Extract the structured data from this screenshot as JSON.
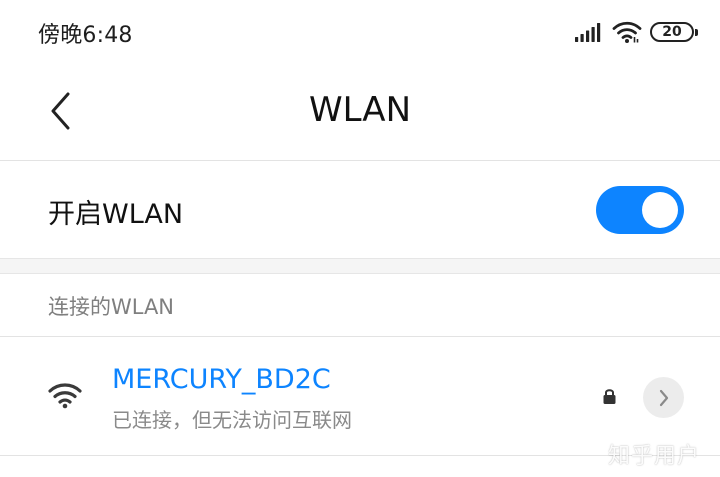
{
  "status_bar": {
    "time": "傍晚6:48",
    "battery_level": "20",
    "icons": [
      "signal-icon",
      "wifi-icon",
      "battery-icon"
    ]
  },
  "header": {
    "back_icon": "chevron-left-icon",
    "title": "WLAN"
  },
  "wlan_toggle": {
    "label": "开启WLAN",
    "enabled": true
  },
  "connected_section": {
    "title": "连接的WLAN",
    "networks": [
      {
        "ssid": "MERCURY_BD2C",
        "status": "已连接，但无法访问互联网",
        "secured": true,
        "icons": [
          "wifi-icon",
          "lock-icon",
          "chevron-right-icon"
        ]
      }
    ]
  },
  "watermark": "知乎用户",
  "colors": {
    "accent": "#0d84ff",
    "text_primary": "#111111",
    "text_secondary": "#8a8a8a",
    "divider": "#e3e3e3",
    "section_gap": "#f5f5f5"
  }
}
